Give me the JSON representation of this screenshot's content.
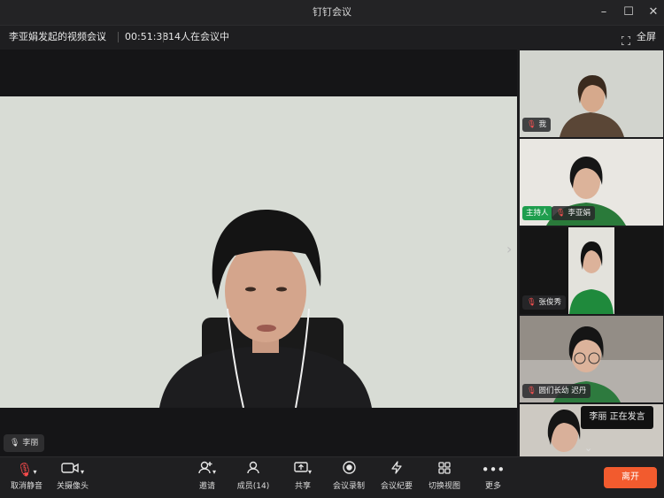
{
  "window": {
    "title": "钉钉会议"
  },
  "meeting": {
    "name": "李亚娟发起的视频会议",
    "timer": "00:51:38",
    "participants_text": "14人在会议中",
    "fullscreen_label": "全屏"
  },
  "main_video": {
    "speaker": "李丽"
  },
  "tiles": [
    {
      "name": "我"
    },
    {
      "name": "李亚娟",
      "badge": "主持人"
    },
    {
      "name": "张俊秀"
    },
    {
      "name": "圆们长幼 迟丹"
    }
  ],
  "tooltip": {
    "text": "李丽  正在发言"
  },
  "toolbar": {
    "unmute": "取消静音",
    "camera": "关摄像头",
    "invite": "邀请",
    "members": "成员(14)",
    "share": "共享",
    "record": "会议录制",
    "minutes": "会议纪要",
    "switch_view": "切换视图",
    "more": "更多",
    "leave": "离开"
  },
  "colors": {
    "leave": "#f25b2e",
    "host_badge": "#1f9e4e",
    "background": "#1b1b1d"
  }
}
